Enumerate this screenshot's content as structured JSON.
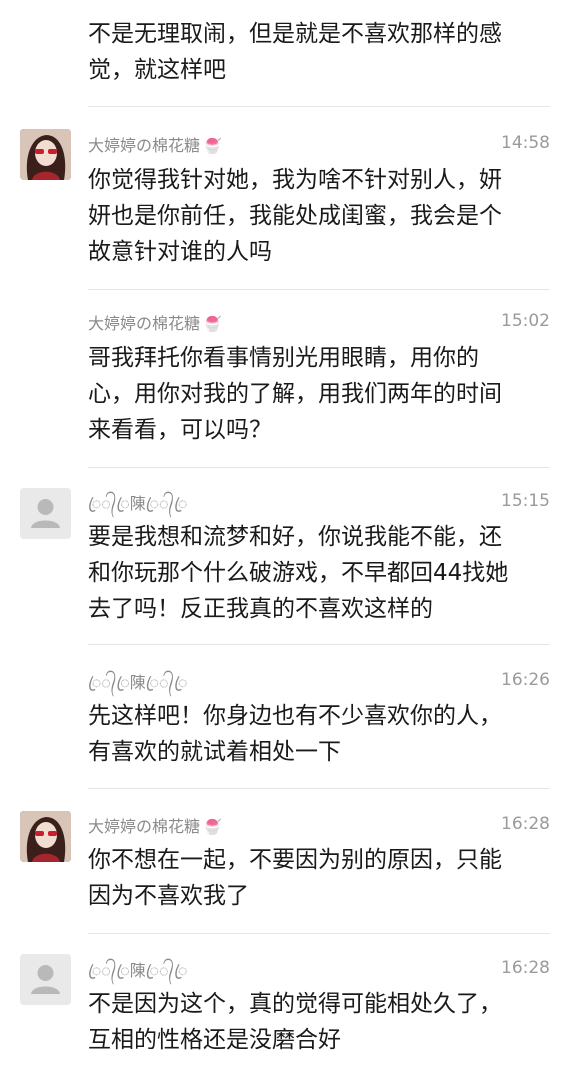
{
  "messages": [
    {
      "avatar": "none",
      "name": "",
      "time": "",
      "lines": [
        "不是无理取闹，但是就是不喜欢那样的感",
        "觉，就这样吧"
      ]
    },
    {
      "avatar": "girl-photo",
      "name": "大婷婷の棉花糖",
      "name_deco": "🍧",
      "time": "14:58",
      "lines": [
        "你觉得我针对她，我为啥不针对别人，妍",
        "妍也是你前任，我能处成闺蜜，我会是个",
        "故意针对谁的人吗"
      ]
    },
    {
      "avatar": "none",
      "name": "大婷婷の棉花糖",
      "name_deco": "🍧",
      "time": "15:02",
      "lines": [
        "哥我拜托你看事情别光用眼睛，用你的",
        "心，用你对我的了解，用我们两年的时间",
        "来看看，可以吗？"
      ]
    },
    {
      "avatar": "default-person",
      "name": "ꦿ᭄ꦿ陳ꦿ᭄ꦿ",
      "time": "15:15",
      "lines": [
        "要是我想和流梦和好，你说我能不能，还",
        "和你玩那个什么破游戏，不早都回44找她",
        "去了吗！反正我真的不喜欢这样的"
      ]
    },
    {
      "avatar": "none",
      "name": "ꦿ᭄ꦿ陳ꦿ᭄ꦿ",
      "time": "16:26",
      "lines": [
        "先这样吧！你身边也有不少喜欢你的人，",
        "有喜欢的就试着相处一下"
      ]
    },
    {
      "avatar": "girl-photo",
      "name": "大婷婷の棉花糖",
      "name_deco": "🍧",
      "time": "16:28",
      "lines": [
        "你不想在一起，不要因为别的原因，只能",
        "因为不喜欢我了"
      ]
    },
    {
      "avatar": "default-person",
      "name": "ꦿ᭄ꦿ陳ꦿ᭄ꦿ",
      "time": "16:28",
      "lines": [
        "不是因为这个，真的觉得可能相处久了，",
        "互相的性格还是没磨合好"
      ]
    }
  ]
}
